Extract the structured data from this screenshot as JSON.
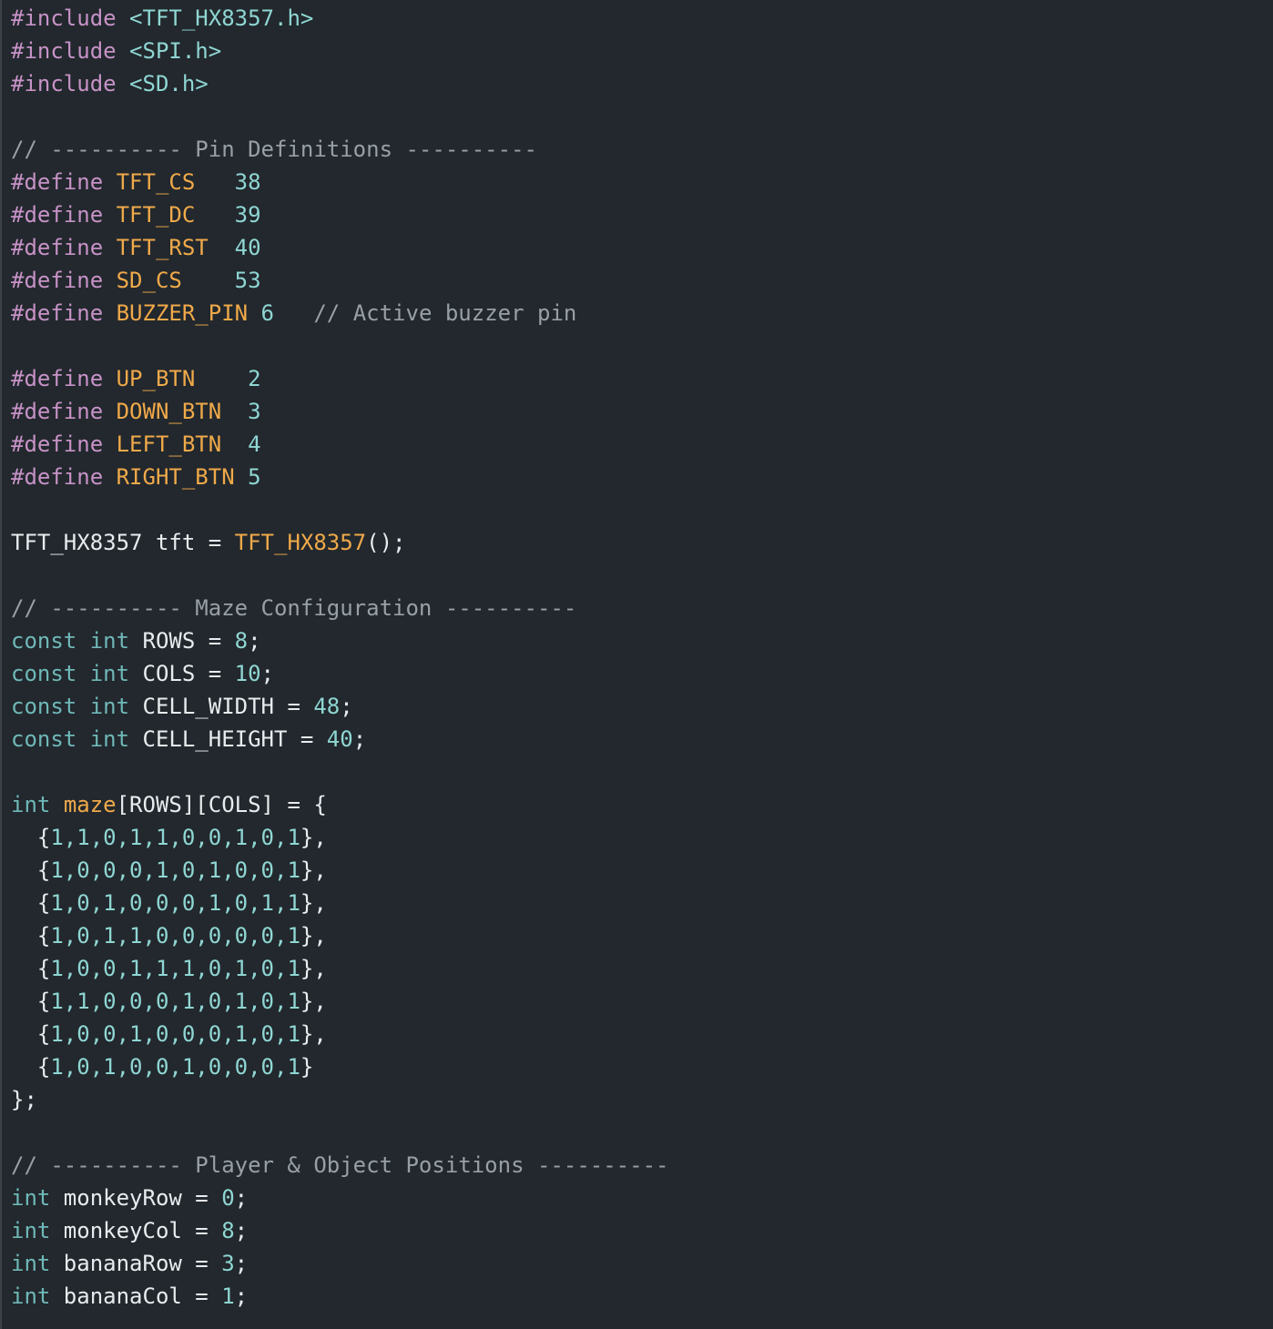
{
  "editor": {
    "language": "C++ (Arduino)",
    "colors": {
      "background": "#22282d",
      "preprocessor": "#c792c7",
      "macro": "#f0a94a",
      "number": "#8fd6d3",
      "comment": "#98a0a6",
      "type": "#6fb8b8",
      "text": "#e8ecef"
    },
    "lines": [
      [
        {
          "t": "pp",
          "v": "#include "
        },
        {
          "t": "header",
          "v": "<TFT_HX8357.h>"
        }
      ],
      [
        {
          "t": "pp",
          "v": "#include "
        },
        {
          "t": "header",
          "v": "<SPI.h>"
        }
      ],
      [
        {
          "t": "pp",
          "v": "#include "
        },
        {
          "t": "header",
          "v": "<SD.h>"
        }
      ],
      [],
      [
        {
          "t": "comment",
          "v": "// ---------- Pin Definitions ----------"
        }
      ],
      [
        {
          "t": "pp",
          "v": "#define "
        },
        {
          "t": "macro",
          "v": "TFT_CS"
        },
        {
          "t": "plain",
          "v": "   "
        },
        {
          "t": "num",
          "v": "38"
        }
      ],
      [
        {
          "t": "pp",
          "v": "#define "
        },
        {
          "t": "macro",
          "v": "TFT_DC"
        },
        {
          "t": "plain",
          "v": "   "
        },
        {
          "t": "num",
          "v": "39"
        }
      ],
      [
        {
          "t": "pp",
          "v": "#define "
        },
        {
          "t": "macro",
          "v": "TFT_RST"
        },
        {
          "t": "plain",
          "v": "  "
        },
        {
          "t": "num",
          "v": "40"
        }
      ],
      [
        {
          "t": "pp",
          "v": "#define "
        },
        {
          "t": "macro",
          "v": "SD_CS"
        },
        {
          "t": "plain",
          "v": "    "
        },
        {
          "t": "num",
          "v": "53"
        }
      ],
      [
        {
          "t": "pp",
          "v": "#define "
        },
        {
          "t": "macro",
          "v": "BUZZER_PIN"
        },
        {
          "t": "plain",
          "v": " "
        },
        {
          "t": "num",
          "v": "6"
        },
        {
          "t": "plain",
          "v": "   "
        },
        {
          "t": "comment",
          "v": "// Active buzzer pin"
        }
      ],
      [],
      [
        {
          "t": "pp",
          "v": "#define "
        },
        {
          "t": "macro",
          "v": "UP_BTN"
        },
        {
          "t": "plain",
          "v": "    "
        },
        {
          "t": "num",
          "v": "2"
        }
      ],
      [
        {
          "t": "pp",
          "v": "#define "
        },
        {
          "t": "macro",
          "v": "DOWN_BTN"
        },
        {
          "t": "plain",
          "v": "  "
        },
        {
          "t": "num",
          "v": "3"
        }
      ],
      [
        {
          "t": "pp",
          "v": "#define "
        },
        {
          "t": "macro",
          "v": "LEFT_BTN"
        },
        {
          "t": "plain",
          "v": "  "
        },
        {
          "t": "num",
          "v": "4"
        }
      ],
      [
        {
          "t": "pp",
          "v": "#define "
        },
        {
          "t": "macro",
          "v": "RIGHT_BTN"
        },
        {
          "t": "plain",
          "v": " "
        },
        {
          "t": "num",
          "v": "5"
        }
      ],
      [],
      [
        {
          "t": "plain",
          "v": "TFT_HX8357 tft = "
        },
        {
          "t": "func",
          "v": "TFT_HX8357"
        },
        {
          "t": "plain",
          "v": "();"
        }
      ],
      [],
      [
        {
          "t": "comment",
          "v": "// ---------- Maze Configuration ----------"
        }
      ],
      [
        {
          "t": "type",
          "v": "const int"
        },
        {
          "t": "plain",
          "v": " ROWS = "
        },
        {
          "t": "num",
          "v": "8"
        },
        {
          "t": "plain",
          "v": ";"
        }
      ],
      [
        {
          "t": "type",
          "v": "const int"
        },
        {
          "t": "plain",
          "v": " COLS = "
        },
        {
          "t": "num",
          "v": "10"
        },
        {
          "t": "plain",
          "v": ";"
        }
      ],
      [
        {
          "t": "type",
          "v": "const int"
        },
        {
          "t": "plain",
          "v": " CELL_WIDTH = "
        },
        {
          "t": "num",
          "v": "48"
        },
        {
          "t": "plain",
          "v": ";"
        }
      ],
      [
        {
          "t": "type",
          "v": "const int"
        },
        {
          "t": "plain",
          "v": " CELL_HEIGHT = "
        },
        {
          "t": "num",
          "v": "40"
        },
        {
          "t": "plain",
          "v": ";"
        }
      ],
      [],
      [
        {
          "t": "type",
          "v": "int"
        },
        {
          "t": "plain",
          "v": " "
        },
        {
          "t": "func",
          "v": "maze"
        },
        {
          "t": "plain",
          "v": "[ROWS][COLS] = {"
        }
      ],
      [
        {
          "t": "plain",
          "v": "  {"
        },
        {
          "t": "num",
          "v": "1,1,0,1,1,0,0,1,0,1"
        },
        {
          "t": "plain",
          "v": "},"
        }
      ],
      [
        {
          "t": "plain",
          "v": "  {"
        },
        {
          "t": "num",
          "v": "1,0,0,0,1,0,1,0,0,1"
        },
        {
          "t": "plain",
          "v": "},"
        }
      ],
      [
        {
          "t": "plain",
          "v": "  {"
        },
        {
          "t": "num",
          "v": "1,0,1,0,0,0,1,0,1,1"
        },
        {
          "t": "plain",
          "v": "},"
        }
      ],
      [
        {
          "t": "plain",
          "v": "  {"
        },
        {
          "t": "num",
          "v": "1,0,1,1,0,0,0,0,0,1"
        },
        {
          "t": "plain",
          "v": "},"
        }
      ],
      [
        {
          "t": "plain",
          "v": "  {"
        },
        {
          "t": "num",
          "v": "1,0,0,1,1,1,0,1,0,1"
        },
        {
          "t": "plain",
          "v": "},"
        }
      ],
      [
        {
          "t": "plain",
          "v": "  {"
        },
        {
          "t": "num",
          "v": "1,1,0,0,0,1,0,1,0,1"
        },
        {
          "t": "plain",
          "v": "},"
        }
      ],
      [
        {
          "t": "plain",
          "v": "  {"
        },
        {
          "t": "num",
          "v": "1,0,0,1,0,0,0,1,0,1"
        },
        {
          "t": "plain",
          "v": "},"
        }
      ],
      [
        {
          "t": "plain",
          "v": "  {"
        },
        {
          "t": "num",
          "v": "1,0,1,0,0,1,0,0,0,1"
        },
        {
          "t": "plain",
          "v": "}"
        }
      ],
      [
        {
          "t": "plain",
          "v": "};"
        }
      ],
      [],
      [
        {
          "t": "comment",
          "v": "// ---------- Player & Object Positions ----------"
        }
      ],
      [
        {
          "t": "type",
          "v": "int"
        },
        {
          "t": "plain",
          "v": " monkeyRow = "
        },
        {
          "t": "num",
          "v": "0"
        },
        {
          "t": "plain",
          "v": ";"
        }
      ],
      [
        {
          "t": "type",
          "v": "int"
        },
        {
          "t": "plain",
          "v": " monkeyCol = "
        },
        {
          "t": "num",
          "v": "8"
        },
        {
          "t": "plain",
          "v": ";"
        }
      ],
      [
        {
          "t": "type",
          "v": "int"
        },
        {
          "t": "plain",
          "v": " bananaRow = "
        },
        {
          "t": "num",
          "v": "3"
        },
        {
          "t": "plain",
          "v": ";"
        }
      ],
      [
        {
          "t": "type",
          "v": "int"
        },
        {
          "t": "plain",
          "v": " bananaCol = "
        },
        {
          "t": "num",
          "v": "1"
        },
        {
          "t": "plain",
          "v": ";"
        }
      ]
    ]
  }
}
